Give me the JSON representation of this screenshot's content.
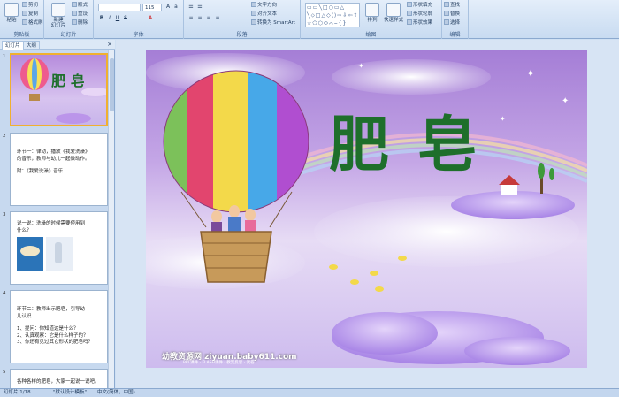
{
  "ribbon": {
    "clipboard": {
      "group": "剪贴板",
      "paste": "粘贴",
      "cut": "剪切",
      "copy": "复制",
      "painter": "格式刷"
    },
    "slides": {
      "group": "幻灯片",
      "new_slide": "新建\n幻灯片",
      "layout": "版式",
      "reset": "重设",
      "delete": "删除"
    },
    "font": {
      "group": "字体",
      "font_name": "",
      "font_size": "115"
    },
    "paragraph": {
      "group": "段落",
      "direction": "文字方向",
      "align": "对齐文本",
      "smartart": "转换为 SmartArt"
    },
    "drawing": {
      "group": "绘图",
      "shapes": "▭▭╲□○▭△ ╲⬦□△◇⟨⟩⇨⇩⇦⇧ ☆⬠⬡⬭⌒⌢{}",
      "arrange": "排列",
      "quick_styles": "快速样式",
      "fill": "形状填充",
      "outline": "形状轮廓",
      "effects": "形状效果"
    },
    "editing": {
      "group": "编辑",
      "find": "查找",
      "replace": "替换",
      "select": "选择"
    }
  },
  "panel": {
    "tab_slides": "幻灯片",
    "tab_outline": "大纲",
    "close": "×",
    "slides": [
      {
        "num": "1",
        "title": "肥 皂"
      },
      {
        "num": "2",
        "lines": [
          "环节一：律动，播放《我爱洗澡》",
          "的音乐，教师与幼儿一起做动作。",
          "",
          "附：《我爱洗澡》音乐"
        ]
      },
      {
        "num": "3",
        "lines": [
          "说一说：洗澡的时候需要使用到",
          "什么？"
        ]
      },
      {
        "num": "4",
        "lines": [
          "环节二：教师出示肥皂，引导幼",
          "儿认识",
          "",
          "1、提问：你知道这是什么？",
          "2、认真观察：它是什么样子的？",
          "3、你还有见过其它形状的肥皂吗？"
        ]
      },
      {
        "num": "5",
        "lines": [
          "各种各样的肥皂，大家一起说一说吧。"
        ]
      }
    ]
  },
  "slide": {
    "title": "肥 皂",
    "website": "幼教资源网 ziyuan.baby611.com",
    "website_sub": "PPT课件 · FLASH课件 · 教案反思 · 试卷"
  },
  "status": {
    "slide_pos": "幻灯片 1/18",
    "theme": "\"默认设计模板\"",
    "lang": "中文(简体，中国)"
  }
}
